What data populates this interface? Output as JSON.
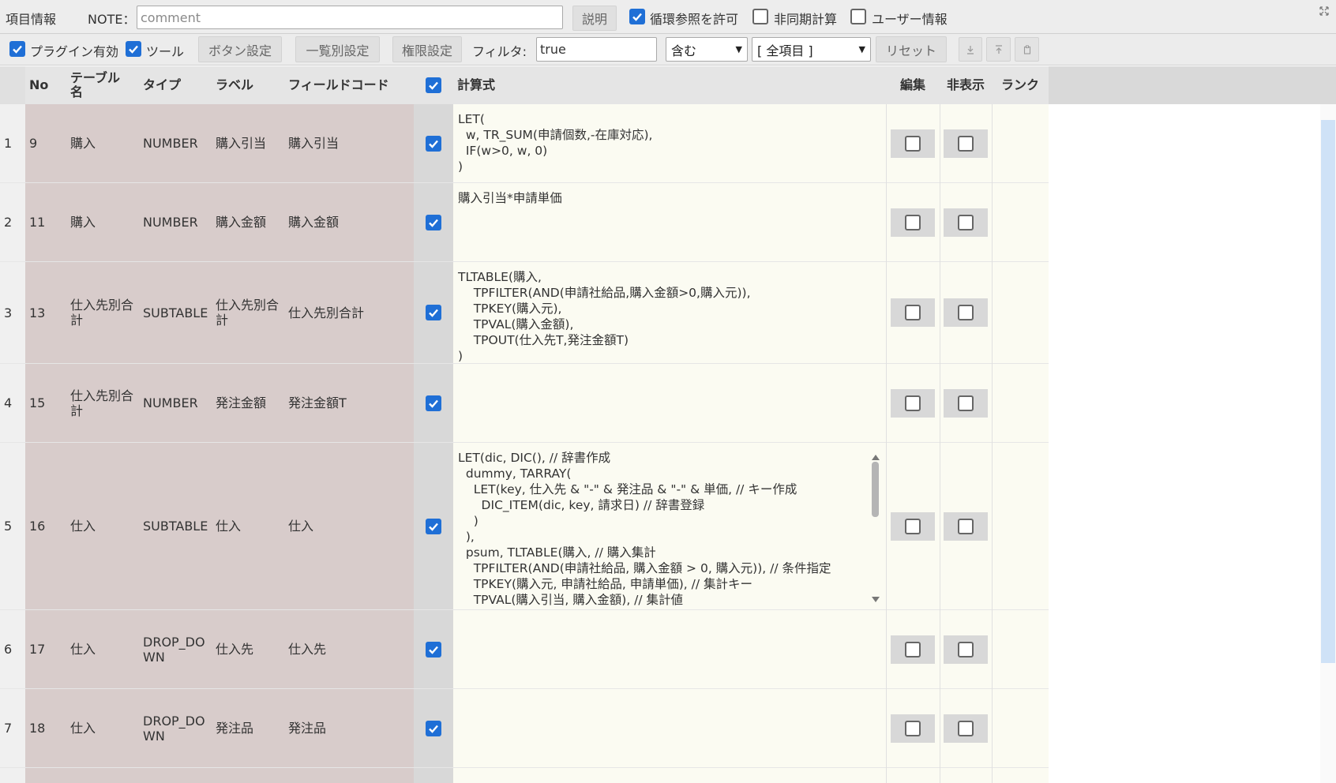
{
  "toolbar1": {
    "item_info_label": "項目情報",
    "note_label": "NOTE：",
    "note_placeholder": "comment",
    "explain_button": "説明",
    "allow_circular_label": "循環参照を許可",
    "allow_circular_checked": true,
    "async_calc_label": "非同期計算",
    "async_calc_checked": false,
    "user_info_label": "ユーザー情報",
    "user_info_checked": false,
    "corner_icon": "expand-icon"
  },
  "toolbar2": {
    "plugin_enabled_label": "プラグイン有効",
    "plugin_enabled_checked": true,
    "tool_label": "ツール",
    "tool_checked": true,
    "button_settings": "ボタン設定",
    "list_settings": "一覧別設定",
    "permission_settings": "権限設定",
    "filter_label": "フィルタ:",
    "filter_value": "true",
    "match_mode": "含む",
    "field_scope": "[ 全項目 ]",
    "reset_button": "リセット",
    "download_icon": "download-icon",
    "upload_icon": "upload-icon",
    "clipboard_icon": "clipboard-icon"
  },
  "table": {
    "headers": {
      "no": "No",
      "table_name": "テーブル名",
      "type": "タイプ",
      "label": "ラベル",
      "field_code": "フィールドコード",
      "formula": "計算式",
      "edit": "編集",
      "hidden": "非表示",
      "rank": "ランク"
    },
    "header_checkbox_checked": true,
    "rows": [
      {
        "index": "1",
        "no": "9",
        "table": "購入",
        "type": "NUMBER",
        "label": "購入引当",
        "code": "購入引当",
        "enabled": true,
        "formula": "LET(\n  w, TR_SUM(申請個数,-在庫対応),\n  IF(w>0, w, 0)\n)"
      },
      {
        "index": "2",
        "no": "11",
        "table": "購入",
        "type": "NUMBER",
        "label": "購入金額",
        "code": "購入金額",
        "enabled": true,
        "formula": "購入引当*申請単価"
      },
      {
        "index": "3",
        "no": "13",
        "table": "仕入先別合計",
        "type": "SUBTABLE",
        "label": "仕入先別合計",
        "code": "仕入先別合計",
        "enabled": true,
        "formula": "TLTABLE(購入,\n    TPFILTER(AND(申請社給品,購入金額>0,購入元)),\n    TPKEY(購入元),\n    TPVAL(購入金額),\n    TPOUT(仕入先T,発注金額T)\n)"
      },
      {
        "index": "4",
        "no": "15",
        "table": "仕入先別合計",
        "type": "NUMBER",
        "label": "発注金額",
        "code": "発注金額T",
        "enabled": true,
        "formula": ""
      },
      {
        "index": "5",
        "no": "16",
        "table": "仕入",
        "type": "SUBTABLE",
        "label": "仕入",
        "code": "仕入",
        "enabled": true,
        "formula": "LET(dic, DIC(), // 辞書作成\n  dummy, TARRAY(\n    LET(key, 仕入先 & \"-\" & 発注品 & \"-\" & 単価, // キー作成\n      DIC_ITEM(dic, key, 請求日) // 辞書登録\n    )\n  ),\n  psum, TLTABLE(購入, // 購入集計\n    TPFILTER(AND(申請社給品, 購入金額 > 0, 購入元)), // 条件指定\n    TPKEY(購入元, 申請社給品, 申請単価), // 集計キー\n    TPVAL(購入引当, 購入金額), // 集計値"
      },
      {
        "index": "6",
        "no": "17",
        "table": "仕入",
        "type": "DROP_DOWN",
        "label": "仕入先",
        "code": "仕入先",
        "enabled": true,
        "formula": ""
      },
      {
        "index": "7",
        "no": "18",
        "table": "仕入",
        "type": "DROP_DOWN",
        "label": "発注品",
        "code": "発注品",
        "enabled": true,
        "formula": ""
      }
    ]
  },
  "colors": {
    "checkbox_blue": "#1f6fd6",
    "brown_cell": "#d8cccb",
    "formula_bg": "#fbfbf2",
    "scrollbar": "#cfe2f7"
  }
}
